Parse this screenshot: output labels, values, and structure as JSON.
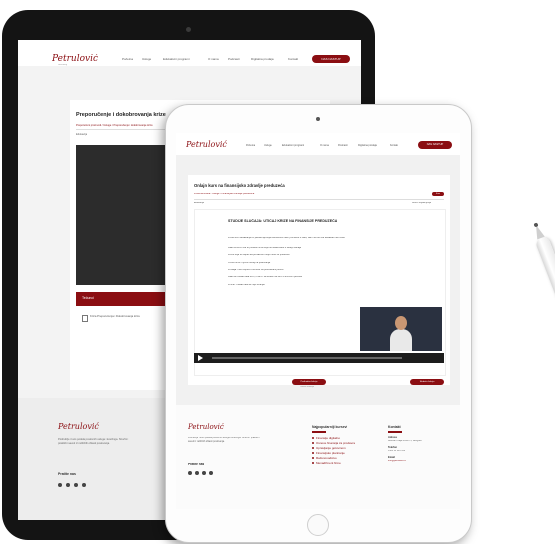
{
  "site": {
    "logo": "Petrulović",
    "logo_sub": "consulting",
    "nav": [
      "Početna",
      "Usluge",
      "Edukativni programi",
      "O nama",
      "Podcasti",
      "Digitalna prodaja",
      "Kontakt"
    ],
    "cta": "NAS NASTUP"
  },
  "back_page": {
    "title": "Preporučenje i dokobrovanja krize",
    "breadcrumb": "Preporučeni proizvodi / Usluge / Preporučenje i dokobrovanje krize",
    "meta": "Edukacija",
    "section_label": "Tečunci",
    "doc_item": "Kriza Preporučenja i Dokobrovanja krize",
    "footer_text": "Podruščje i kurs podela poslovnih usluga i koučinga. Stručni i praktični saveti iz različitih oblasti poslovanja.",
    "follow": "Pratite nas"
  },
  "front_page": {
    "card_title": "Onlajn kurs na finansijsko zdravlje preduzeća",
    "breadcrumb": "Početna strana / Usluge / Finansijsko zdravlje preduzeća",
    "badge": "Kurs",
    "meta_left": "Edukacija",
    "meta_right": "Autori objašnjenja",
    "video_heading": "STUDIJE SLUČAJA: UTICAJ KRIZE NA FINANSIJE PREDUZEĆA",
    "bullets": [
      "Pored svih dešavanja uz pandemiju koja izaziva kod nas i promene u radu, čak i što se sve dešavalo na tržištu",
      "Kako su kroz sve to prolazili firme koje su analizirane u studiji slučaja",
      "Firme koje su uspeli da prevaziđu i koje mere su preduzeli",
      "Uzroci krize i njihov uticaj na poslovanje",
      "Prodaja i nivo ispred u odnosu na posmatrani period",
      "Kako se trošak rada od 1,5 na 2 i sa strane na 40% u kriznom periodu",
      "Primer: trošak rada se nije smanjio"
    ],
    "prev_btn": "Prethodna lekcija",
    "prev_sub": "Osnovi finansija",
    "next_btn": "Sledeća lekcija",
    "footer_text": "Podruščje i kurs podela poslovnih usluga i koučinga. Stručni i praktični saveti iz različitih oblasti poslovanja.",
    "follow": "Pratite nas",
    "col2_title": "Najpopularniji kursevi",
    "col2_links": [
      "Finansije digitalno",
      "Osnove finansija za prodavce",
      "Upravljanje gotovinom",
      "Finansijsko planiranje",
      "Računovodstvo",
      "Menadžment firme"
    ],
    "col3_title": "Kontakt",
    "address_label": "Adresa",
    "address": "Bulevar Kralja Petra I 1, Beograd",
    "phone_label": "Telefon",
    "phone": "+381 11 123 456",
    "email_label": "Email",
    "email": "info@petrulovic.rs"
  },
  "colors": {
    "brand": "#8b0e12",
    "device_dark": "#141414",
    "device_light": "#fdfdfd"
  },
  "icons": [
    "play-icon",
    "social-icon",
    "file-icon",
    "camera-icon"
  ]
}
